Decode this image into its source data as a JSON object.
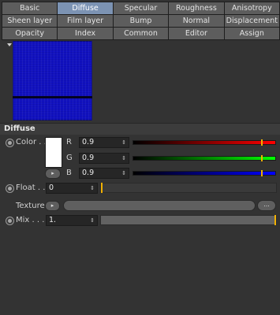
{
  "tabs": [
    {
      "label": "Basic",
      "active": false
    },
    {
      "label": "Diffuse",
      "active": true
    },
    {
      "label": "Specular",
      "active": false
    },
    {
      "label": "Roughness",
      "active": false
    },
    {
      "label": "Anisotropy",
      "active": false
    },
    {
      "label": "Sheen layer",
      "active": false
    },
    {
      "label": "Film layer",
      "active": false
    },
    {
      "label": "Bump",
      "active": false
    },
    {
      "label": "Normal",
      "active": false
    },
    {
      "label": "Displacement",
      "active": false
    },
    {
      "label": "Opacity",
      "active": false
    },
    {
      "label": "Index",
      "active": false
    },
    {
      "label": "Common",
      "active": false
    },
    {
      "label": "Editor",
      "active": false
    },
    {
      "label": "Assign",
      "active": false
    }
  ],
  "section": {
    "title": "Diffuse"
  },
  "color": {
    "label": "Color . .",
    "swatch_color": "#ffffff",
    "expand_glyph": "▸",
    "channels": [
      {
        "label": "R",
        "value": "0.9",
        "fraction": 0.9
      },
      {
        "label": "G",
        "value": "0.9",
        "fraction": 0.9
      },
      {
        "label": "B",
        "value": "0.9",
        "fraction": 0.9
      }
    ]
  },
  "float": {
    "label": "Float . .",
    "value": "0",
    "fraction": 0
  },
  "texture": {
    "label": "Texture",
    "button_glyph": "▸",
    "more_label": "..."
  },
  "mix": {
    "label": "Mix . . .",
    "value": "1.",
    "fraction": 1.0
  },
  "icons": {
    "spinner": "⇕",
    "preview_toggle": "triangle-down"
  }
}
